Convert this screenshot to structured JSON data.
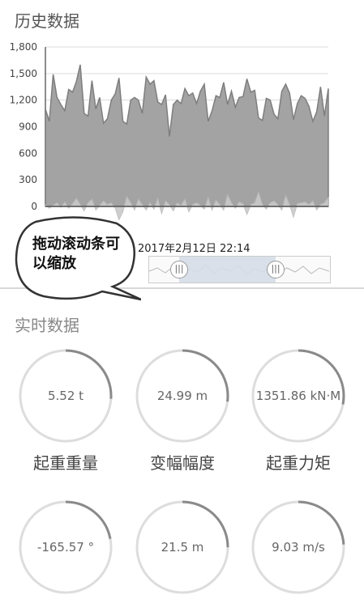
{
  "history": {
    "title": "历史数据",
    "timestamp": "2017年2月12日 22:14",
    "tooltip": "拖动滚动条可以缩放"
  },
  "chart_data": {
    "type": "area",
    "ylim": [
      0,
      1800
    ],
    "yticks": [
      "0",
      "300",
      "600",
      "900",
      "1,200",
      "1,500",
      "1,800"
    ],
    "grid": true,
    "series": [
      {
        "values": [
          1100,
          960,
          1490,
          1230,
          1150,
          1080,
          1320,
          1290,
          1410,
          1600,
          1050,
          1020,
          1420,
          1100,
          1230,
          940,
          990,
          1200,
          1270,
          1450,
          960,
          930,
          1200,
          1230,
          1200,
          1050,
          1460,
          1380,
          1420,
          1180,
          1150,
          1260,
          790,
          1150,
          1200,
          1160,
          1330,
          1250,
          1280,
          1160,
          1300,
          1380,
          960,
          1080,
          1250,
          1230,
          1400,
          1150,
          1300,
          1120,
          1230,
          1240,
          1440,
          1290,
          1310,
          1000,
          970,
          1220,
          1200,
          1040,
          990,
          1300,
          1380,
          1280,
          980,
          1160,
          1250,
          1220,
          1130,
          960,
          1070,
          1350,
          1020,
          1330
        ]
      },
      {
        "values": [
          20,
          -20,
          10,
          40,
          -10,
          50,
          -20,
          30,
          90,
          20,
          -50,
          40,
          80,
          -40,
          10,
          60,
          20,
          40,
          -20,
          -150,
          -60,
          110,
          40,
          -40,
          80,
          20,
          -40,
          40,
          -30,
          90,
          -80,
          60,
          20,
          -50,
          40,
          10,
          80,
          -60,
          20,
          40,
          10,
          -30,
          100,
          -40,
          70,
          20,
          -40,
          130,
          40,
          -20,
          50,
          30,
          -90,
          20,
          40,
          160,
          20,
          -30,
          40,
          60,
          20,
          -40,
          120,
          20,
          -120,
          30,
          40,
          50,
          20,
          60,
          -40,
          20,
          40,
          100
        ]
      }
    ]
  },
  "realtime": {
    "title": "实时数据",
    "gauges": [
      {
        "value": "5.52 t",
        "label": "起重重量",
        "fraction": 0.26
      },
      {
        "value": "24.99 m",
        "label": "变幅幅度",
        "fraction": 0.27
      },
      {
        "value": "1351.86 kN·M",
        "label": "起重力矩",
        "fraction": 0.28
      },
      {
        "value": "-165.57 °",
        "label": "",
        "fraction": 0.22
      },
      {
        "value": "21.5 m",
        "label": "",
        "fraction": 0.25
      },
      {
        "value": "9.03 m/s",
        "label": "",
        "fraction": 0.24
      }
    ]
  },
  "colors": {
    "area_primary": "#a3a3a3",
    "area_line": "#7e7e7e",
    "area_secondary": "#c9c9c9",
    "gauge_track": "#dddddd",
    "gauge_arc": "#8a8a8a"
  }
}
